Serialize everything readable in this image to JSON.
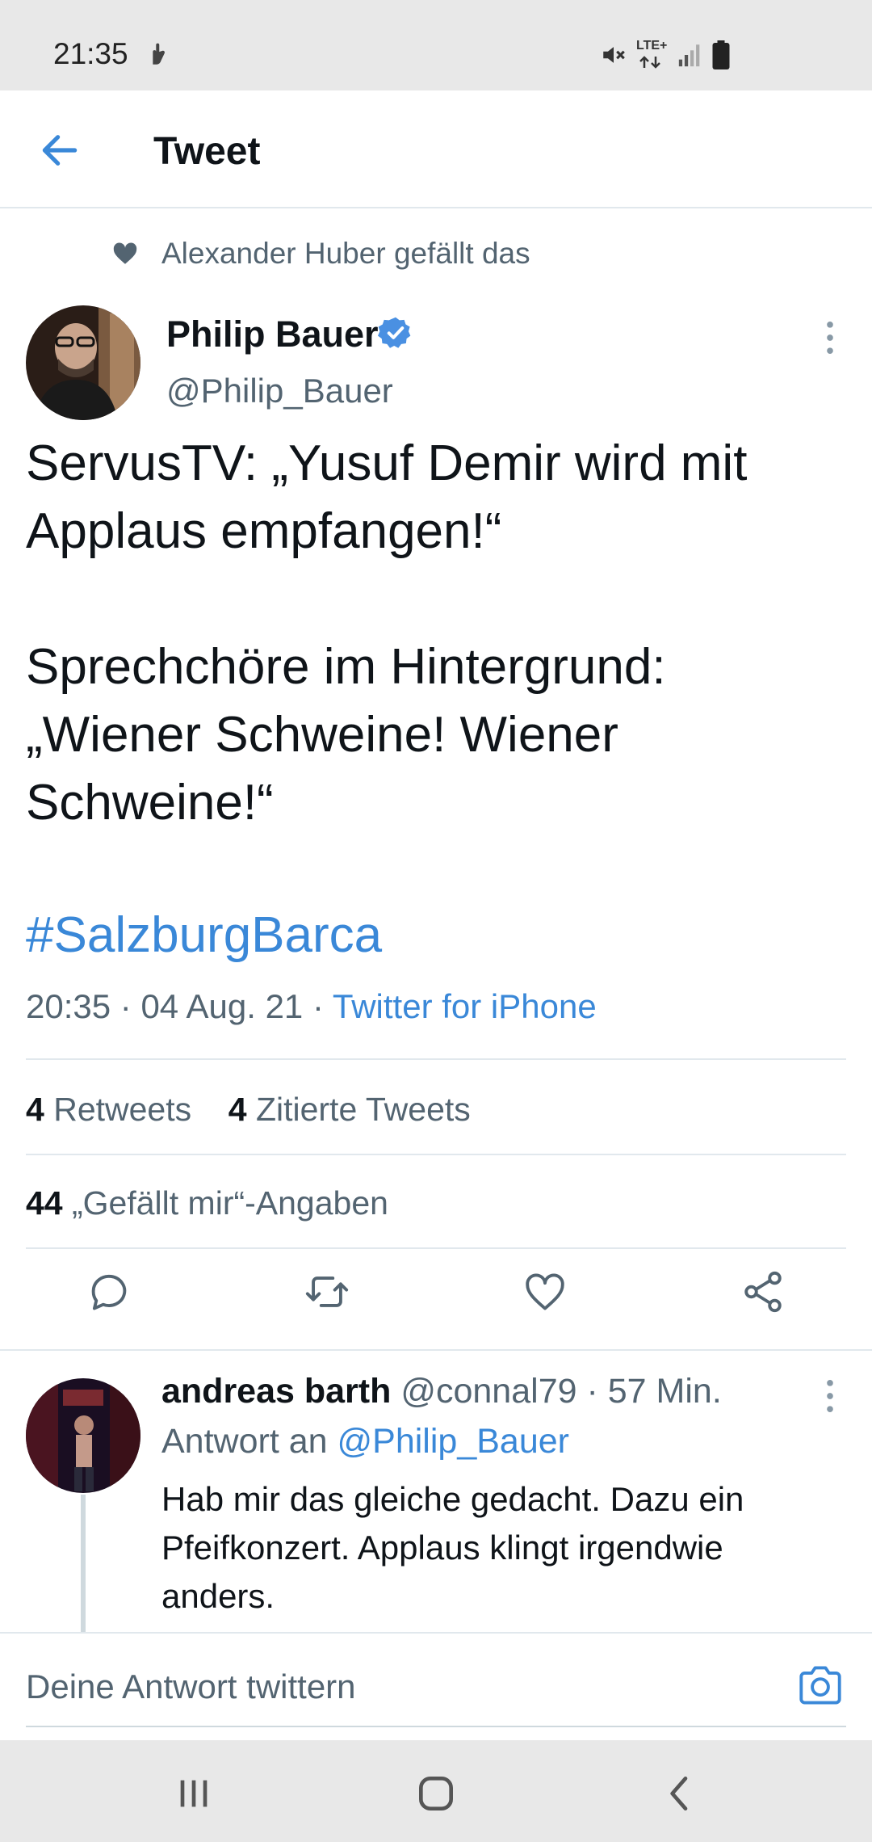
{
  "status_bar": {
    "time": "21:35",
    "network": "LTE+"
  },
  "header": {
    "title": "Tweet",
    "back_icon": "arrow-left-icon"
  },
  "social_context": {
    "text": "Alexander Huber gefällt das",
    "icon": "heart-filled-icon"
  },
  "tweet": {
    "author_name": "Philip Bauer",
    "author_handle": "@Philip_Bauer",
    "verified": true,
    "lines": [
      "ServusTV: „Yusuf Demir wird mit",
      "Applaus empfangen!“",
      "",
      "Sprechchöre im Hintergrund:",
      "„Wiener Schweine! Wiener",
      "Schweine!“"
    ],
    "hashtag": "#SalzburgBarca",
    "time": "20:35",
    "separator": " · ",
    "date": "04 Aug. 21",
    "source": "Twitter for iPhone"
  },
  "stats": {
    "retweets_count": "4",
    "retweets_label": "Retweets",
    "quotes_count": "4",
    "quotes_label": "Zitierte Tweets",
    "likes_count": "44",
    "likes_label": "„Gefällt mir“-Angaben"
  },
  "actions": [
    "reply-icon",
    "retweet-icon",
    "like-icon",
    "share-icon"
  ],
  "reply": {
    "author_name": "andreas barth",
    "author_handle": "@connal79",
    "separator": " · ",
    "time_ago": "57 Min.",
    "reply_to_label": "Antwort an ",
    "reply_to_handle": "@Philip_Bauer",
    "lines": [
      "Hab mir das gleiche gedacht. Dazu ein",
      "Pfeifkonzert. Applaus klingt irgendwie",
      "anders."
    ]
  },
  "compose": {
    "placeholder": "Deine Antwort twittern",
    "icon": "camera-icon"
  },
  "colors": {
    "accent": "#3a88d8",
    "secondary_text": "#536471",
    "primary_text": "#0f1419",
    "verified": "#4a90e2"
  }
}
